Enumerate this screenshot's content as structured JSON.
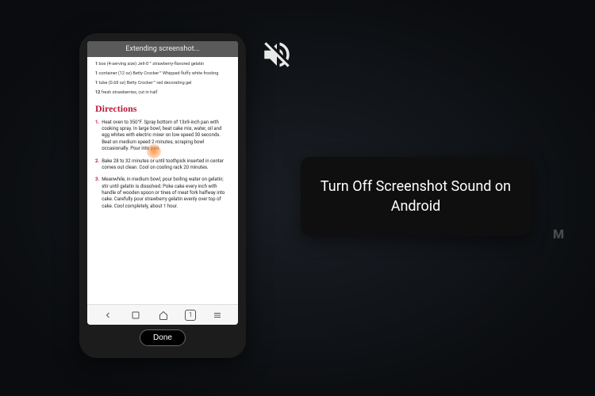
{
  "topbar": {
    "text": "Extending screenshot..."
  },
  "ingredients": [
    {
      "qty": "1",
      "text": "box (4-serving size) Jell-O™ strawberry-flavored gelatin"
    },
    {
      "qty": "1",
      "text": "container (12 oz) Betty Crocker™ Whipped fluffy white frosting"
    },
    {
      "qty": "1",
      "text": "tube (0.68 oz) Betty Crocker™ red decorating gel"
    },
    {
      "qty": "12",
      "text": "fresh strawberries, cut in half"
    }
  ],
  "directions": {
    "title": "Directions",
    "steps": [
      {
        "num": "1.",
        "text": "Heat oven to 350°F. Spray bottom of 13x9-inch pan with cooking spray. In large bowl, beat cake mix, water, oil and egg whites with electric mixer on low speed 30 seconds. Beat on medium speed 2 minutes, scraping bowl occasionally. Pour into pan."
      },
      {
        "num": "2.",
        "text": "Bake 28 to 32 minutes or until toothpick inserted in center comes out clean. Cool on cooling rack 20 minutes."
      },
      {
        "num": "3.",
        "text": "Meanwhile, in medium bowl, pour boiling water on gelatin; stir until gelatin is dissolved. Poke cake every inch with handle of wooden spoon or tines of meat fork halfway into cake. Carefully pour strawberry gelatin evenly over top of cake. Cool completely, about 1 hour."
      }
    ]
  },
  "navbar": {
    "back_label": "back",
    "home_label": "home",
    "tabs_count": "1",
    "menu_label": "menu"
  },
  "done": {
    "label": "Done"
  },
  "tooltip": {
    "text": "Turn Off Screenshot Sound on Android"
  },
  "watermark": {
    "text": "M"
  }
}
